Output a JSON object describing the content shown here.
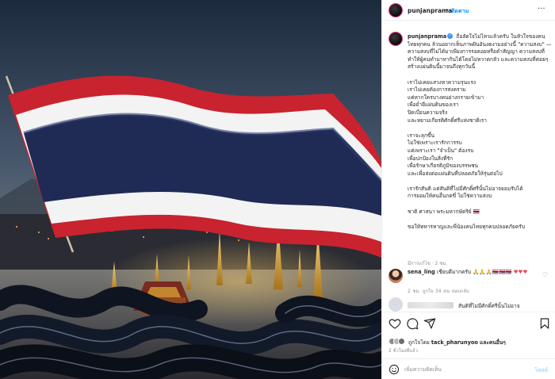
{
  "post": {
    "username": "punjanprama",
    "follow_dot": "•",
    "follow_label": "ติดตาม",
    "more_label": "···"
  },
  "caption": {
    "username": "punjanprama",
    "text": "ถือลัดใจไม่ไหวแล้วครับ ในหัวใจของคนไทยทุกคน ล้วนอยากเห็นภาพฝันอันงดงามอย่างนี้ \"ความสงบ\" — ความสงบที่ไม่ได้มาเพียงการรอคอยหรือคำสัญญา ความสงบที่ทำให้ผู้คนทำมาหากินได้โดยไม่หวาดกลัว และความสงบที่ค่อยๆสร้างแผ่นดินนี้มาจนถึงทุกวันนี้\n\nเราไม่เคยแสวงหาความรุนแรง\nเราไม่เคยต้องการสงคราม\nแต่หากใครบางคนย่างกรายเข้ามา\nเพื่อย่ำยีแผ่นดินของเรา\nปิดเบือนความจริง\nและหยามเกียรติศักดิ์ศรีแห่งชาติเรา\n\nเราจะลุกขึ้น\nไม่ใช่เพราะเรารักการรบ\nแต่เพราะเรา \"จำเป็น\" ต้องรบ\nเพื่อปกป้องในสิ่งที่รัก\nเพื่อรักษาเกียรติภูมิของบรรพชน\nและเพื่อส่งต่อแผ่นดินที่ปลอดภัยให้รุ่นต่อไป\n\nเรารักสันติ แต่สันติที่ไม่มีศักดิ์ศรีนั้นไม่อาจยอมรับได้\nการยอมให้คนอื่นกดขี่ ไม่ใช่ความสงบ\n\nชาติ ศาสนา พระมหากษัตริย์ 🇹🇭\n\nขอให้ทหารหาญและพี่น้องคนไทยทุกคนปลอดภัยครับ",
    "edited": "มีการแก้ไข · 2 ชม."
  },
  "comments": [
    {
      "username": "sena_ling",
      "text": "เชียบดีมากครับ 🙏🙏🙏🇹🇭🇹🇭🇹🇭",
      "heart": "♥♥♥",
      "meta": "2 ชม.  ถูกใจ 34 คน  ตอบกลับ"
    },
    {
      "username": "",
      "text": "สันติที่ไม่มีศักดิ์ศรีนั้นไม่อาจ"
    }
  ],
  "likes": {
    "prefix": "ถูกใจโดย",
    "user": "tack_pharunyoo",
    "suffix": "และคนอื่นๆ",
    "time": "2 ชั่วโมงที่แล้ว"
  },
  "add_comment": {
    "placeholder": "เพิ่มความคิดเห็น",
    "post_label": "โพสต์"
  },
  "colors": {
    "accent_blue": "#0095f6",
    "flag_red": "#c8232f",
    "flag_white": "#f5f5f5",
    "flag_blue": "#1f2a55"
  },
  "icons": [
    "heart-icon",
    "comment-icon",
    "share-icon",
    "bookmark-icon",
    "emoji-icon",
    "more-icon",
    "verified-icon"
  ]
}
